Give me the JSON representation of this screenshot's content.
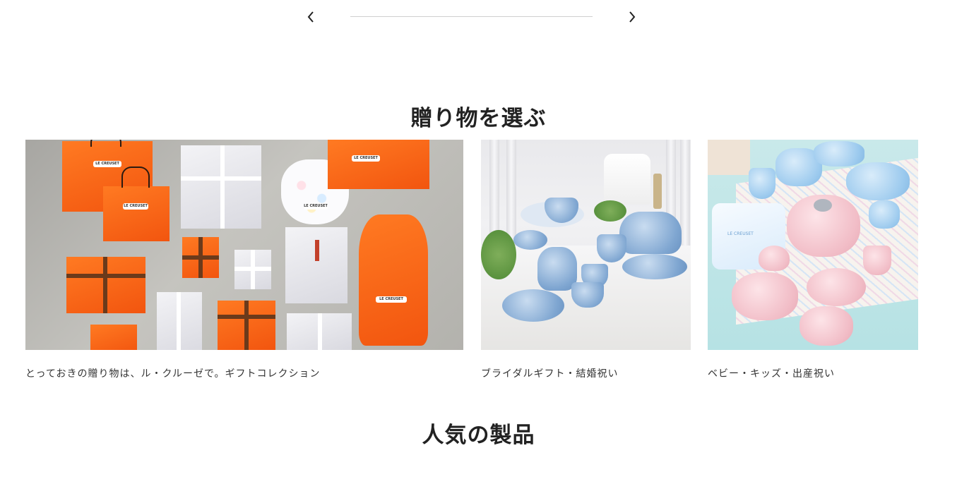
{
  "carousel": {
    "prev_icon": "chevron-left-icon",
    "next_icon": "chevron-right-icon"
  },
  "gift_section": {
    "title": "贈り物を選ぶ",
    "cards": [
      {
        "caption": "とっておきの贈り物は、ル・クルーゼで。ギフトコレクション",
        "image_label": "LE CREUSET"
      },
      {
        "caption": "ブライダルギフト・結婚祝い"
      },
      {
        "caption": "ベビー・キッズ・出産祝い",
        "image_label": "LE CREUSET"
      }
    ]
  },
  "popular_section": {
    "title": "人気の製品"
  },
  "colors": {
    "text": "#222222",
    "brand_orange": "#f2550f",
    "progress_track": "#cfcfcf"
  }
}
